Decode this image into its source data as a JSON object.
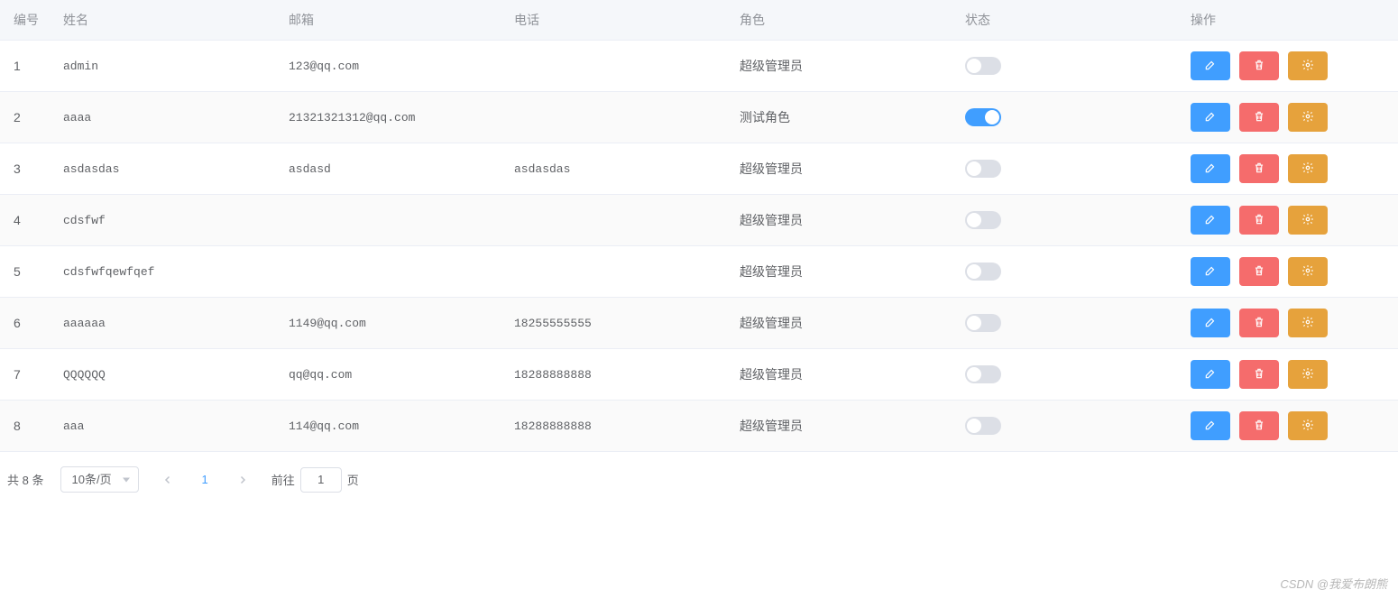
{
  "columns": {
    "id": "编号",
    "name": "姓名",
    "email": "邮箱",
    "phone": "电话",
    "role": "角色",
    "status": "状态",
    "action": "操作"
  },
  "rows": [
    {
      "id": "1",
      "name": "admin",
      "email": "123@qq.com",
      "phone": "",
      "role": "超级管理员",
      "status": false
    },
    {
      "id": "2",
      "name": "aaaa",
      "email": "21321321312@qq.com",
      "phone": "",
      "role": "测试角色",
      "status": true
    },
    {
      "id": "3",
      "name": "asdasdas",
      "email": "asdasd",
      "phone": "asdasdas",
      "role": "超级管理员",
      "status": false
    },
    {
      "id": "4",
      "name": "cdsfwf",
      "email": "",
      "phone": "",
      "role": "超级管理员",
      "status": false
    },
    {
      "id": "5",
      "name": "cdsfwfqewfqef",
      "email": "",
      "phone": "",
      "role": "超级管理员",
      "status": false
    },
    {
      "id": "6",
      "name": "aaaaaa",
      "email": "1149@qq.com",
      "phone": "18255555555",
      "role": "超级管理员",
      "status": false
    },
    {
      "id": "7",
      "name": "QQQQQQ",
      "email": "qq@qq.com",
      "phone": "18288888888",
      "role": "超级管理员",
      "status": false
    },
    {
      "id": "8",
      "name": "aaa",
      "email": "114@qq.com",
      "phone": "18288888888",
      "role": "超级管理员",
      "status": false
    }
  ],
  "pagination": {
    "total_prefix": "共",
    "total_count": "8",
    "total_suffix": "条",
    "page_size_label": "10条/页",
    "current_page": "1",
    "jump_prefix": "前往",
    "jump_value": "1",
    "jump_suffix": "页"
  },
  "watermark": "CSDN @我爱布朗熊"
}
